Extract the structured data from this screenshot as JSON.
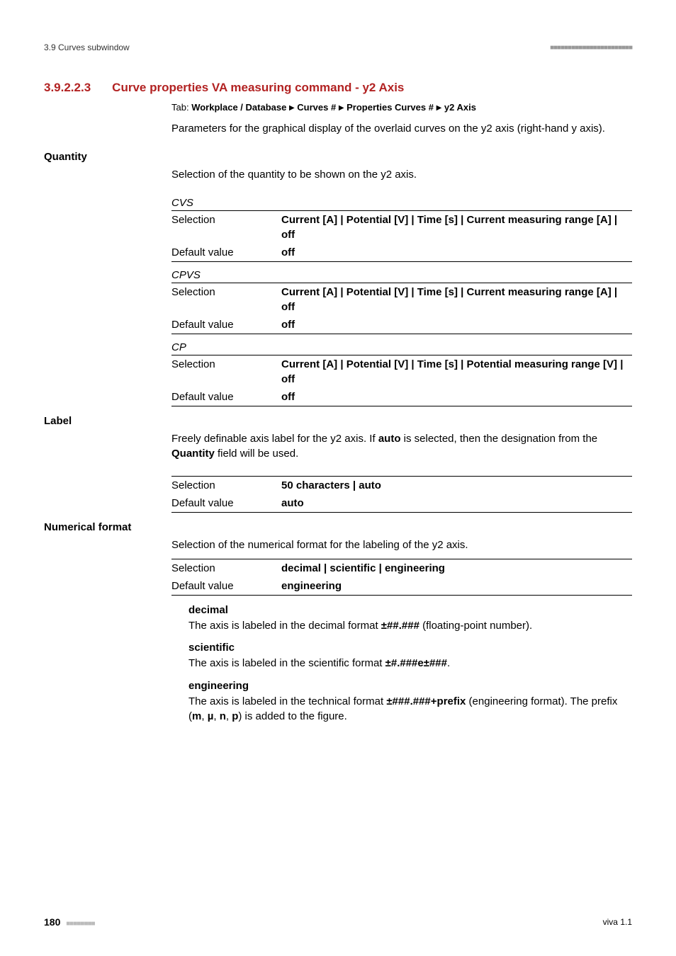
{
  "header": {
    "left": "3.9 Curves subwindow"
  },
  "section": {
    "num": "3.9.2.2.3",
    "title": "Curve properties VA measuring command - y2 Axis"
  },
  "tab": {
    "label": "Tab: ",
    "path_1": "Workplace / Database ",
    "path_2": " Curves # ",
    "path_3": " Properties Curves # ",
    "path_4": " y2 Axis"
  },
  "intro_para": "Parameters for the graphical display of the overlaid curves on the y2 axis (right-hand y axis).",
  "quantity": {
    "label": "Quantity",
    "desc": "Selection of the quantity to be shown on the y2 axis.",
    "groups": [
      {
        "name": "CVS",
        "selection": "Current [A] | Potential [V] | Time [s] | Current measuring range [A] | off",
        "default": "off"
      },
      {
        "name": "CPVS",
        "selection": "Current [A] | Potential [V] | Time [s] | Current measuring range [A] | off",
        "default": "off"
      },
      {
        "name": "CP",
        "selection": "Current [A] | Potential [V] | Time [s] | Potential measuring range [V] | off",
        "default": "off"
      }
    ],
    "row_selection": "Selection",
    "row_default": "Default value"
  },
  "label_section": {
    "label": "Label",
    "desc_1": "Freely definable axis label for the y2 axis. If ",
    "desc_bold1": "auto",
    "desc_2": " is selected, then the designation from the ",
    "desc_bold2": "Quantity",
    "desc_3": " field will be used.",
    "selection": "50 characters | auto",
    "default": "auto"
  },
  "numfmt": {
    "label": "Numerical format",
    "desc": "Selection of the numerical format for the labeling of the y2 axis.",
    "selection": "decimal | scientific | engineering",
    "default": "engineering",
    "items": [
      {
        "term": "decimal",
        "text_1": "The axis is labeled in the decimal format ",
        "bold": "±##.###",
        "text_2": " (floating-point number)."
      },
      {
        "term": "scientific",
        "text_1": "The axis is labeled in the scientific format ",
        "bold": "±#.###e±###",
        "text_2": "."
      },
      {
        "term": "engineering",
        "text_1": "The axis is labeled in the technical format ",
        "bold": "±###.###+prefix",
        "text_2": " (engineering format). The prefix (",
        "bold_m": "m",
        "sep1": ", ",
        "bold_mu": "µ",
        "sep2": ", ",
        "bold_n": "n",
        "sep3": ", ",
        "bold_p": "p",
        "text_3": ") is added to the figure."
      }
    ]
  },
  "footer": {
    "page": "180",
    "right": "viva 1.1"
  }
}
